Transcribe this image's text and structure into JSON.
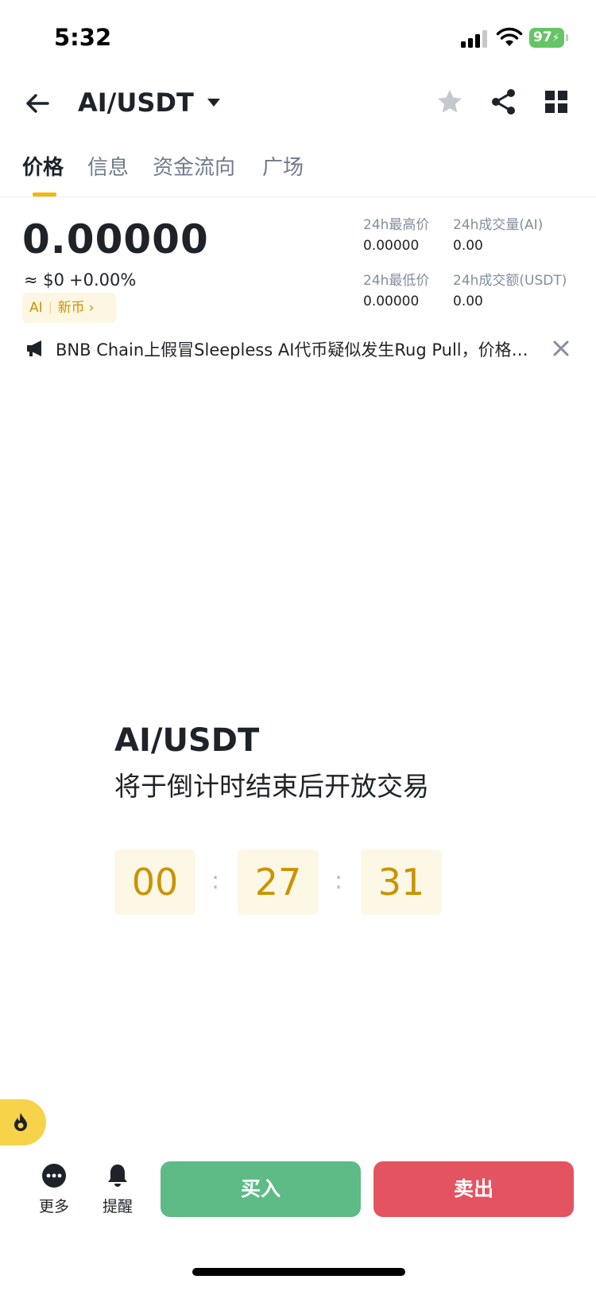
{
  "status_bar": {
    "time": "5:32",
    "battery": "97"
  },
  "header": {
    "pair": "AI/USDT",
    "icons": [
      "back-arrow-icon",
      "caret-down-icon",
      "star-icon",
      "share-icon",
      "grid-icon"
    ]
  },
  "tabs": [
    {
      "label": "价格",
      "active": true
    },
    {
      "label": "信息",
      "active": false
    },
    {
      "label": "资金流向",
      "active": false
    },
    {
      "label": "广场",
      "active": false
    }
  ],
  "price": {
    "last": "0.00000",
    "usd": "≈ $0",
    "change": "+0.00%",
    "tag_symbol": "AI",
    "tag_label": "新币",
    "tag_chevron": "›"
  },
  "stats": [
    {
      "label": "24h最高价",
      "value": "0.00000"
    },
    {
      "label": "24h成交量(AI)",
      "value": "0.00"
    },
    {
      "label": "24h最低价",
      "value": "0.00000"
    },
    {
      "label": "24h成交额(USDT)",
      "value": "0.00"
    }
  ],
  "announcement": {
    "text": "BNB Chain上假冒Sleepless AI代币疑似发生Rug Pull，价格暴跌"
  },
  "countdown": {
    "pair": "AI/USDT",
    "message": "将于倒计时结束后开放交易",
    "hours": "00",
    "minutes": "27",
    "seconds": "31",
    "separator": ":"
  },
  "bottom_bar": {
    "more_label": "更多",
    "alert_label": "提醒",
    "buy_label": "买入",
    "sell_label": "卖出"
  },
  "colors": {
    "accent": "#f0b90b",
    "buy": "#5ebb86",
    "sell": "#e35360",
    "countdown_text": "#c99400"
  }
}
